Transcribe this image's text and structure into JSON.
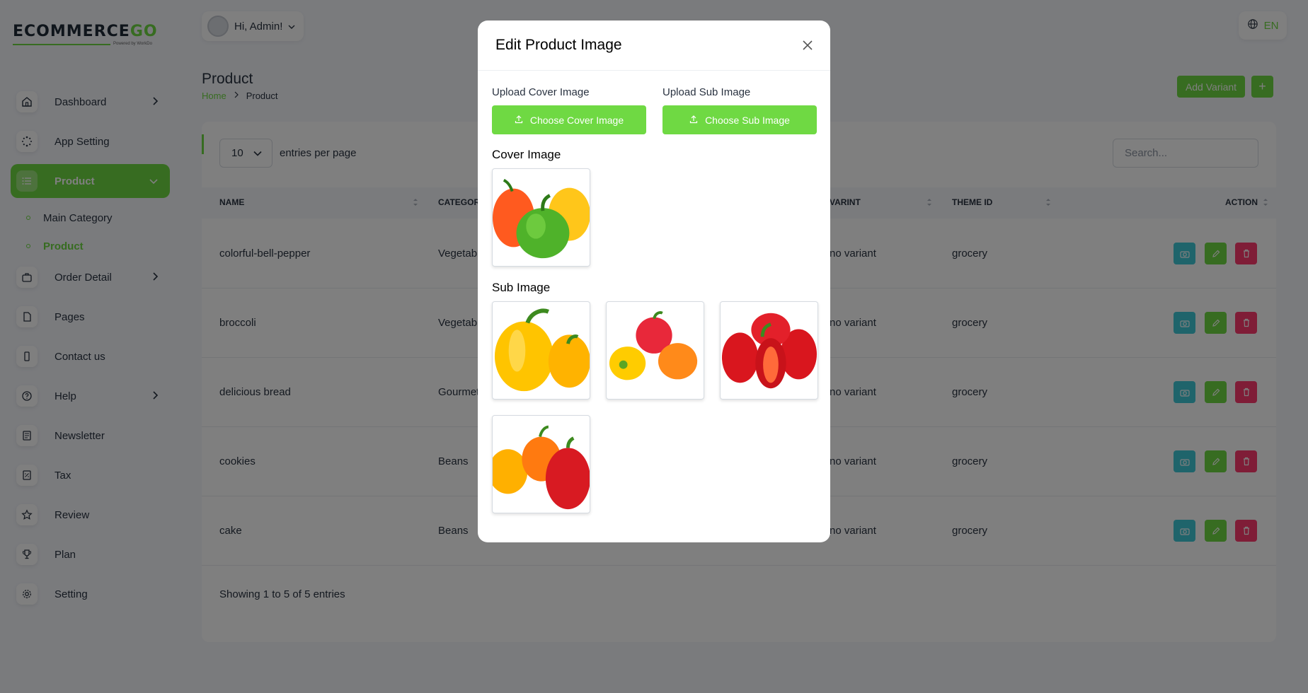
{
  "brand": {
    "name_main": "ECOMMERCE",
    "name_accent": "GO",
    "tagline": "Powered by WorkDo"
  },
  "sidebar": {
    "items": [
      {
        "label": "Dashboard",
        "icon": "home-icon",
        "has_chevron": true
      },
      {
        "label": "App Setting",
        "icon": "settings-dots-icon",
        "has_chevron": false
      },
      {
        "label": "Product",
        "icon": "list-icon",
        "has_chevron": true,
        "active": true
      },
      {
        "label": "Order Detail",
        "icon": "briefcase-icon",
        "has_chevron": true
      },
      {
        "label": "Pages",
        "icon": "file-icon",
        "has_chevron": false
      },
      {
        "label": "Contact us",
        "icon": "phone-icon",
        "has_chevron": false
      },
      {
        "label": "Help",
        "icon": "question-icon",
        "has_chevron": true
      },
      {
        "label": "Newsletter",
        "icon": "news-icon",
        "has_chevron": false
      },
      {
        "label": "Tax",
        "icon": "receipt-icon",
        "has_chevron": false
      },
      {
        "label": "Review",
        "icon": "star-icon",
        "has_chevron": false
      },
      {
        "label": "Plan",
        "icon": "trophy-icon",
        "has_chevron": false
      },
      {
        "label": "Setting",
        "icon": "gear-icon",
        "has_chevron": false
      }
    ],
    "sub_items": [
      {
        "label": "Main Category"
      },
      {
        "label": "Product",
        "active": true
      }
    ]
  },
  "header": {
    "greeting": "Hi, Admin!",
    "language": "EN"
  },
  "page": {
    "title": "Product",
    "breadcrumb": [
      "Home",
      "Product"
    ],
    "add_variant": "Add Variant",
    "add_plus": "+"
  },
  "table": {
    "entries_value": "10",
    "entries_label": "entries per page",
    "search_placeholder": "Search...",
    "columns": [
      "NAME",
      "CATEGOR",
      "VARINT",
      "THEME ID",
      "ACTION"
    ],
    "rows": [
      {
        "name": "colorful-bell-pepper",
        "category": "Vegetabl",
        "variant": "no variant",
        "theme": "grocery"
      },
      {
        "name": "broccoli",
        "category": "Vegetabl",
        "variant": "no variant",
        "theme": "grocery"
      },
      {
        "name": "delicious bread",
        "category": "Gourmet",
        "variant": "no variant",
        "theme": "grocery"
      },
      {
        "name": "cookies",
        "category": "Beans",
        "variant": "no variant",
        "theme": "grocery"
      },
      {
        "name": "cake",
        "category": "Beans",
        "variant": "no variant",
        "theme": "grocery"
      }
    ],
    "showing": "Showing 1 to 5 of 5 entries"
  },
  "modal": {
    "title": "Edit Product Image",
    "upload_cover_label": "Upload Cover Image",
    "upload_sub_label": "Upload Sub Image",
    "choose_cover": "Choose Cover Image",
    "choose_sub": "Choose Sub Image",
    "cover_title": "Cover Image",
    "sub_title": "Sub Image"
  },
  "colors": {
    "accent": "#6fd943",
    "info": "#3ec9d6",
    "danger": "#ff3a6e"
  }
}
